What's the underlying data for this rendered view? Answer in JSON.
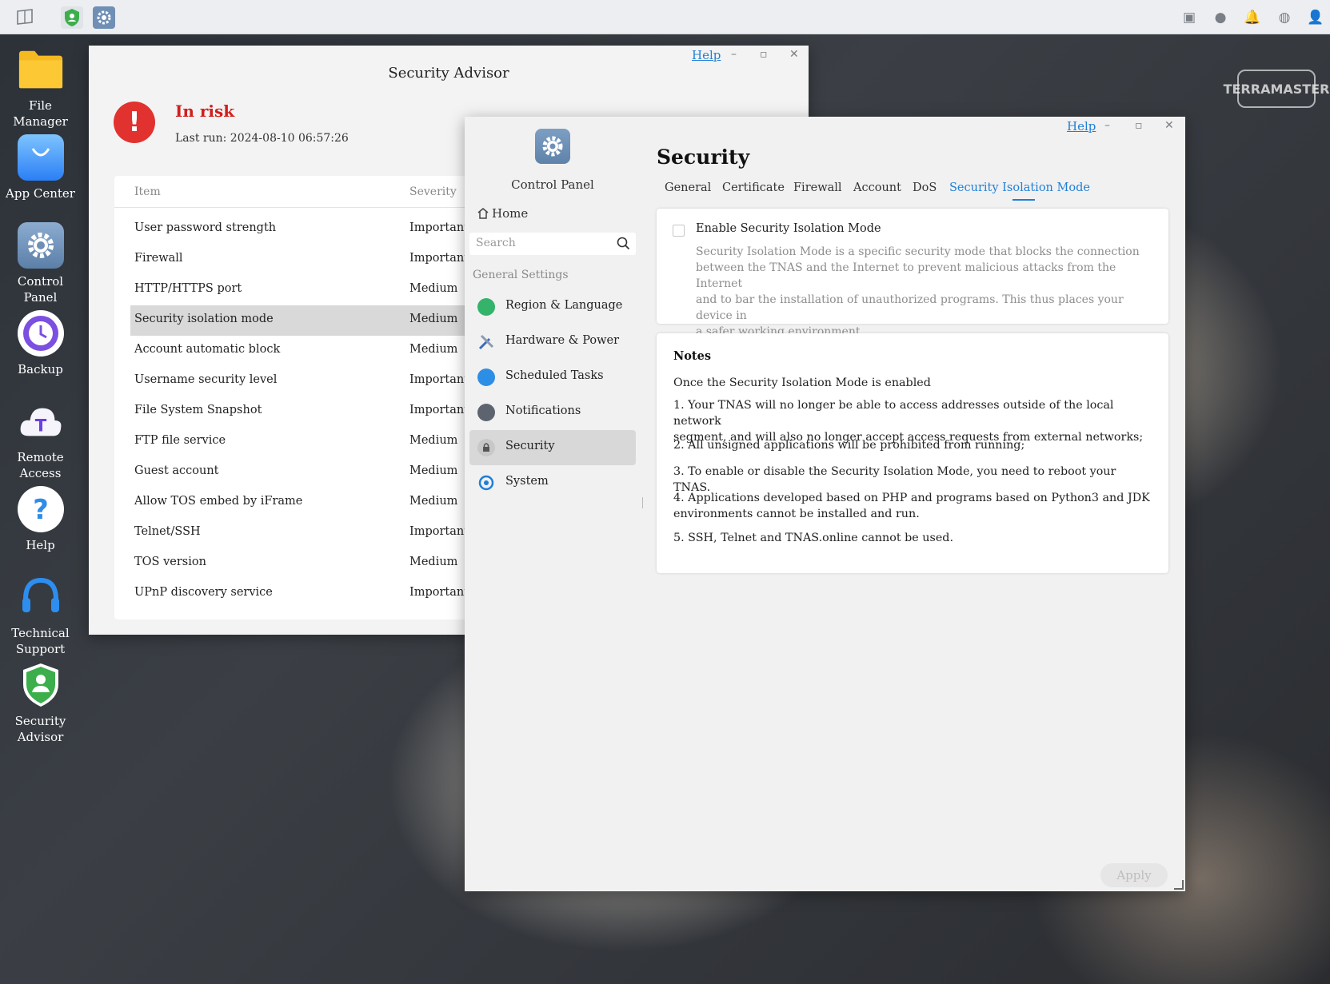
{
  "taskbar": {
    "left_icons": [
      "show-desktop-icon",
      "security-advisor-icon",
      "control-panel-icon"
    ],
    "right_icons": [
      "monitor-icon",
      "chat-icon",
      "bell-icon",
      "globe-icon",
      "user-icon"
    ]
  },
  "desktop": {
    "icons": [
      {
        "label": "File Manager",
        "icon": "folder-icon"
      },
      {
        "label": "App Center",
        "icon": "shopping-bag-icon"
      },
      {
        "label": "Control Panel",
        "icon": "gear-icon"
      },
      {
        "label": "Backup",
        "icon": "clock-icon"
      },
      {
        "label": "Remote Access",
        "icon": "cloud-icon"
      },
      {
        "label": "Help",
        "icon": "question-icon"
      },
      {
        "label": "Technical Support",
        "icon": "headset-icon"
      },
      {
        "label": "Security Advisor",
        "icon": "shield-icon"
      }
    ],
    "brand_logo": "TERRAMASTER"
  },
  "security_advisor": {
    "title": "Security Advisor",
    "help": "Help",
    "status": "In risk",
    "last_run": "Last run: 2024-08-10 06:57:26",
    "columns": {
      "item": "Item",
      "severity": "Severity"
    },
    "rows": [
      {
        "item": "User password strength",
        "severity": "Important"
      },
      {
        "item": "Firewall",
        "severity": "Important"
      },
      {
        "item": "HTTP/HTTPS port",
        "severity": "Medium"
      },
      {
        "item": "Security isolation mode",
        "severity": "Medium"
      },
      {
        "item": "Account automatic block",
        "severity": "Medium"
      },
      {
        "item": "Username security level",
        "severity": "Important"
      },
      {
        "item": "File System Snapshot",
        "severity": "Important"
      },
      {
        "item": "FTP file service",
        "severity": "Medium"
      },
      {
        "item": "Guest account",
        "severity": "Medium"
      },
      {
        "item": "Allow TOS embed by iFrame",
        "severity": "Medium"
      },
      {
        "item": "Telnet/SSH",
        "severity": "Important"
      },
      {
        "item": "TOS version",
        "severity": "Medium"
      },
      {
        "item": "UPnP discovery service",
        "severity": "Important"
      }
    ]
  },
  "control_panel": {
    "app_name": "Control Panel",
    "help": "Help",
    "home": "Home",
    "search_placeholder": "Search",
    "section_label": "General Settings",
    "nav": [
      {
        "label": "Region & Language",
        "icon": "globe-icon"
      },
      {
        "label": "Hardware & Power",
        "icon": "tools-icon"
      },
      {
        "label": "Scheduled Tasks",
        "icon": "list-icon"
      },
      {
        "label": "Notifications",
        "icon": "message-icon"
      },
      {
        "label": "Security",
        "icon": "lock-icon"
      },
      {
        "label": "System",
        "icon": "refresh-icon"
      }
    ],
    "page_title": "Security",
    "tabs": [
      "General",
      "Certificate",
      "Firewall",
      "Account",
      "DoS",
      "Security Isolation Mode"
    ],
    "active_tab": "Security Isolation Mode",
    "enable_label": "Enable Security Isolation Mode",
    "enable_checked": false,
    "description_lines": [
      "Security Isolation Mode is a specific security mode that blocks the connection",
      "between the TNAS and the Internet to prevent malicious attacks from the Internet",
      "and to bar the installation of unauthorized programs. This thus places your device in",
      "a safer working environment."
    ],
    "notes_title": "Notes",
    "notes_intro": "Once the Security Isolation Mode is enabled",
    "notes": [
      [
        "1. Your TNAS will no longer be able to access addresses outside of the local network",
        "segment, and will also no longer accept access requests from external networks;"
      ],
      [
        "2. All unsigned applications will be prohibited from running;"
      ],
      [
        "3. To enable or disable the Security Isolation Mode, you need to reboot your TNAS."
      ],
      [
        "4. Applications developed based on PHP and programs based on Python3 and JDK",
        "environments cannot be installed and run."
      ],
      [
        "5. SSH, Telnet and TNAS.online cannot be used."
      ]
    ],
    "apply": "Apply"
  },
  "colors": {
    "accent": "#1f7fd6",
    "risk": "#d01f1c"
  }
}
